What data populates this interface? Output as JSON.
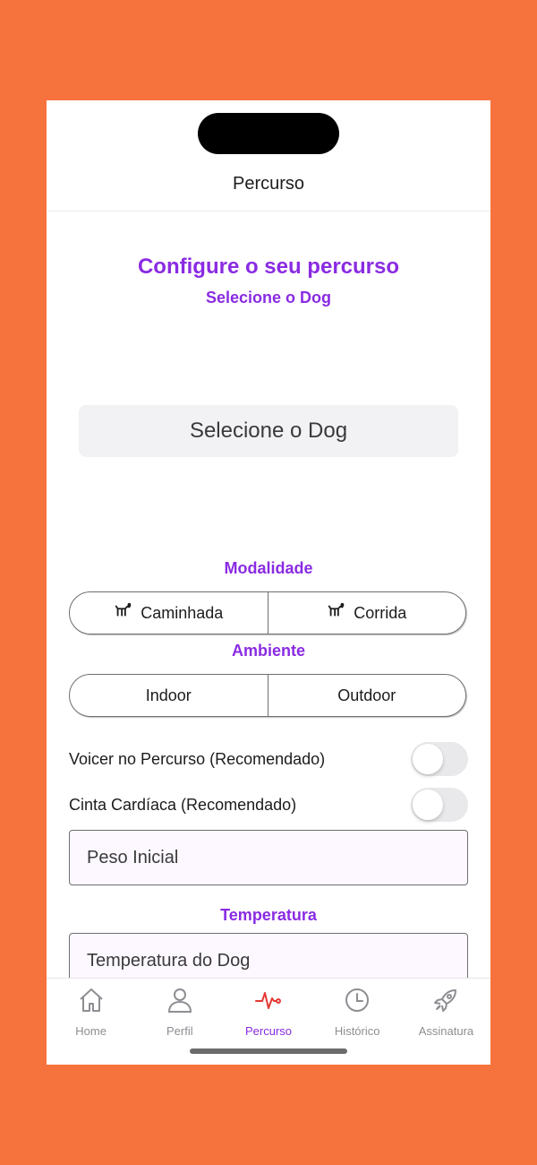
{
  "nav": {
    "title": "Percurso"
  },
  "header": {
    "title": "Configure o seu percurso",
    "subtitle": "Selecione o Dog"
  },
  "dog_select": {
    "label": "Selecione o Dog"
  },
  "modalidade": {
    "label": "Modalidade",
    "options": [
      {
        "label": "Caminhada",
        "icon": "dog-walk-icon"
      },
      {
        "label": "Corrida",
        "icon": "dog-run-icon"
      }
    ]
  },
  "ambiente": {
    "label": "Ambiente",
    "options": [
      {
        "label": "Indoor"
      },
      {
        "label": "Outdoor"
      }
    ]
  },
  "toggles": [
    {
      "label": "Voicer no Percurso (Recomendado)",
      "on": false
    },
    {
      "label": "Cinta Cardíaca (Recomendado)",
      "on": false
    }
  ],
  "peso": {
    "placeholder": "Peso Inicial"
  },
  "temperatura": {
    "label": "Temperatura",
    "placeholder": "Temperatura do Dog"
  },
  "tabs": [
    {
      "label": "Home",
      "icon": "home-icon",
      "active": false
    },
    {
      "label": "Perfil",
      "icon": "person-icon",
      "active": false
    },
    {
      "label": "Percurso",
      "icon": "heartbeat-icon",
      "active": true
    },
    {
      "label": "Histórico",
      "icon": "clock-icon",
      "active": false
    },
    {
      "label": "Assinatura",
      "icon": "rocket-icon",
      "active": false
    }
  ],
  "colors": {
    "background": "#F7733D",
    "accent": "#8A2BE2",
    "active_icon": "#E53935"
  }
}
